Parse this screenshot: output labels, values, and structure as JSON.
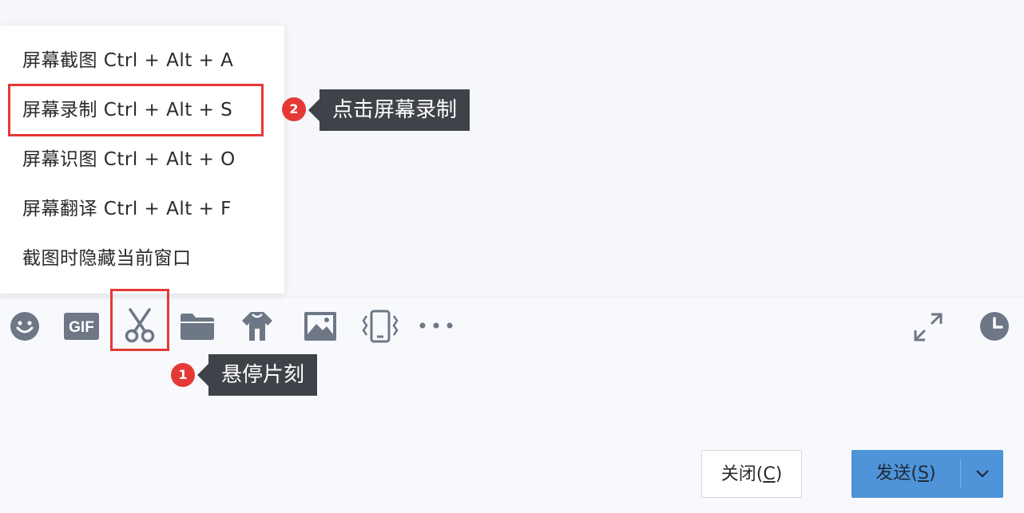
{
  "menu": {
    "items": [
      {
        "label": "屏幕截图 Ctrl + Alt + A"
      },
      {
        "label": "屏幕录制 Ctrl + Alt + S"
      },
      {
        "label": "屏幕识图 Ctrl + Alt + O"
      },
      {
        "label": "屏幕翻译 Ctrl + Alt + F"
      },
      {
        "label": "截图时隐藏当前窗口"
      }
    ]
  },
  "annotations": {
    "step1": {
      "number": "1",
      "text": "悬停片刻"
    },
    "step2": {
      "number": "2",
      "text": "点击屏幕录制"
    }
  },
  "toolbar": {
    "gif_label": "GIF",
    "icons": [
      "emoji-icon",
      "gif-icon",
      "scissors-icon",
      "folder-icon",
      "shirt-icon",
      "image-icon",
      "shake-icon",
      "more-icon",
      "expand-icon",
      "history-icon"
    ]
  },
  "buttons": {
    "close_prefix": "关闭(",
    "close_key": "C",
    "close_suffix": ")",
    "send_prefix": "发送(",
    "send_key": "S",
    "send_suffix": ")"
  },
  "colors": {
    "highlight": "#e53935",
    "tooltip_bg": "#3f4248",
    "send_button": "#4f93d8",
    "icon": "#6d7786"
  }
}
